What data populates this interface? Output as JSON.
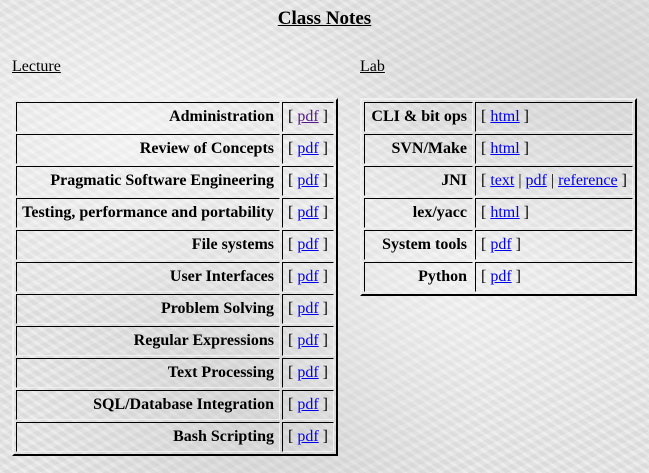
{
  "page": {
    "title": "Class Notes"
  },
  "lecture": {
    "heading": "Lecture",
    "rows": [
      {
        "topic": "Administration",
        "links": [
          {
            "label": "pdf",
            "visited": true
          }
        ]
      },
      {
        "topic": "Review of Concepts",
        "links": [
          {
            "label": "pdf",
            "visited": false
          }
        ]
      },
      {
        "topic": "Pragmatic Software Engineering",
        "links": [
          {
            "label": "pdf",
            "visited": false
          }
        ]
      },
      {
        "topic": "Testing, performance and portability",
        "links": [
          {
            "label": "pdf",
            "visited": false
          }
        ]
      },
      {
        "topic": "File systems",
        "links": [
          {
            "label": "pdf",
            "visited": false
          }
        ]
      },
      {
        "topic": "User Interfaces",
        "links": [
          {
            "label": "pdf",
            "visited": false
          }
        ]
      },
      {
        "topic": "Problem Solving",
        "links": [
          {
            "label": "pdf",
            "visited": false
          }
        ]
      },
      {
        "topic": "Regular Expressions",
        "links": [
          {
            "label": "pdf",
            "visited": false
          }
        ]
      },
      {
        "topic": "Text Processing",
        "links": [
          {
            "label": "pdf",
            "visited": false
          }
        ]
      },
      {
        "topic": "SQL/Database Integration",
        "links": [
          {
            "label": "pdf",
            "visited": false
          }
        ]
      },
      {
        "topic": "Bash Scripting",
        "links": [
          {
            "label": "pdf",
            "visited": false
          }
        ]
      }
    ]
  },
  "lab": {
    "heading": "Lab",
    "rows": [
      {
        "topic": "CLI & bit ops",
        "links": [
          {
            "label": "html",
            "visited": false
          }
        ]
      },
      {
        "topic": "SVN/Make",
        "links": [
          {
            "label": "html",
            "visited": false
          }
        ]
      },
      {
        "topic": "JNI",
        "links": [
          {
            "label": "text",
            "visited": false
          },
          {
            "label": "pdf",
            "visited": false
          },
          {
            "label": "reference",
            "visited": false
          }
        ]
      },
      {
        "topic": "lex/yacc",
        "links": [
          {
            "label": "html",
            "visited": false
          }
        ]
      },
      {
        "topic": "System tools",
        "links": [
          {
            "label": "pdf",
            "visited": false
          }
        ]
      },
      {
        "topic": "Python",
        "links": [
          {
            "label": "pdf",
            "visited": false
          }
        ]
      }
    ]
  },
  "colors": {
    "link": "#0000ee",
    "visited_link": "#551a8b",
    "background": "#e6e6e6"
  }
}
